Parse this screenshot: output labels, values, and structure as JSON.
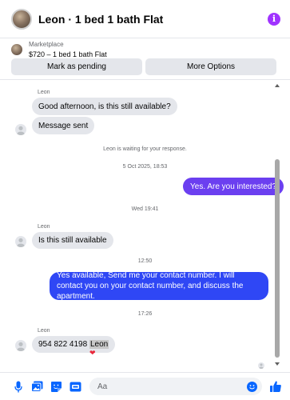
{
  "header": {
    "title": "Leon · 1 bed 1 bath Flat"
  },
  "listing": {
    "source": "Marketplace",
    "summary": "$720 – 1 bed 1 bath Flat",
    "buttons": {
      "mark_pending": "Mark as pending",
      "more_options": "More Options"
    }
  },
  "conversation": {
    "group1": {
      "sender": "Leon",
      "message1": "Good afternoon, is this still available?",
      "message2": "Message sent"
    },
    "waiting_notice": "Leon is waiting for your response.",
    "timestamp1": "5 Oct 2025, 18:53",
    "outgoing1": "Yes. Are you interested?",
    "timestamp2": "Wed 19:41",
    "group2": {
      "sender": "Leon",
      "message": "Is this still available"
    },
    "timestamp3": "12:50",
    "outgoing2": "Yes available, Send me your contact number. I will contact you on your contact number, and discuss the apartment.",
    "timestamp4": "17:26",
    "group3": {
      "sender": "Leon",
      "message_number": "954 822 4198",
      "message_name": "Leon",
      "reaction": "❤"
    }
  },
  "composer": {
    "placeholder": "Aa"
  },
  "colors": {
    "accent": "#0866ff",
    "outgoing_bubble_1": "#6b3ff0",
    "outgoing_bubble_2": "#2f47f5",
    "info_icon": "#a033ff",
    "incoming_bubble": "#e4e6eb"
  },
  "icons": {
    "header_info": "info-icon",
    "composer_tools": [
      "microphone-icon",
      "photo-icon",
      "sticker-icon",
      "gif-icon"
    ],
    "composer_emoji": "smiley-icon",
    "composer_send": "thumbs-up-icon"
  }
}
